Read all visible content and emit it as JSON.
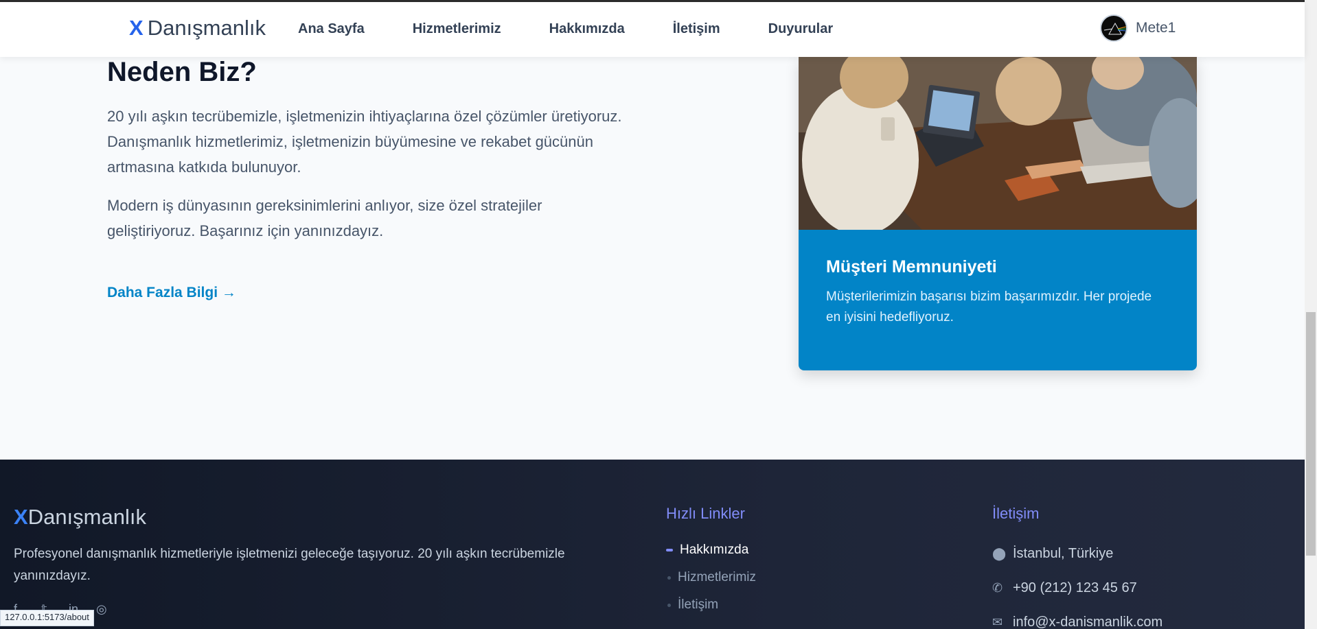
{
  "header": {
    "logo_x": "X",
    "logo_text": "Danışmanlık",
    "nav": [
      "Ana Sayfa",
      "Hizmetlerimiz",
      "Hakkımızda",
      "İletişim",
      "Duyurular"
    ],
    "username": "Mete1"
  },
  "main": {
    "title": "Neden Biz?",
    "para1": "20 yılı aşkın tecrübemizle, işletmenizin ihtiyaçlarına özel çözümler üretiyoruz. Danışmanlık hizmetlerimiz, işletmenizin büyümesine ve rekabet gücünün artmasına katkıda bulunuyor.",
    "para2": "Modern iş dünyasının gereksinimlerini anlıyor, size özel stratejiler geliştiriyoruz. Başarınız için yanınızdayız.",
    "more_link": "Daha Fazla Bilgi →",
    "card": {
      "title": "Müşteri Memnuniyeti",
      "text": "Müşterilerimizin başarısı bizim başarımızdır. Her projede en iyisini hedefliyoruz."
    }
  },
  "footer": {
    "logo_x": "X",
    "logo_text": "Danışmanlık",
    "description": "Profesyonel danışmanlık hizmetleriyle işletmenizi geleceğe taşıyoruz. 20 yılı aşkın tecrübemizle yanınızdayız.",
    "quick_links_title": "Hızlı Linkler",
    "quick_links": [
      "Hakkımızda",
      "Hizmetlerimiz",
      "İletişim"
    ],
    "contact_title": "İletişim",
    "contact": {
      "address": "İstanbul, Türkiye",
      "phone": "+90 (212) 123 45 67",
      "email": "info@x-danismanlik.com"
    }
  },
  "status_url": "127.0.0.1:5173/about",
  "colors": {
    "accent": "#2563eb",
    "card_bg": "#0284c7",
    "footer_heading": "#818cf8",
    "footer_bg": "#111827"
  }
}
